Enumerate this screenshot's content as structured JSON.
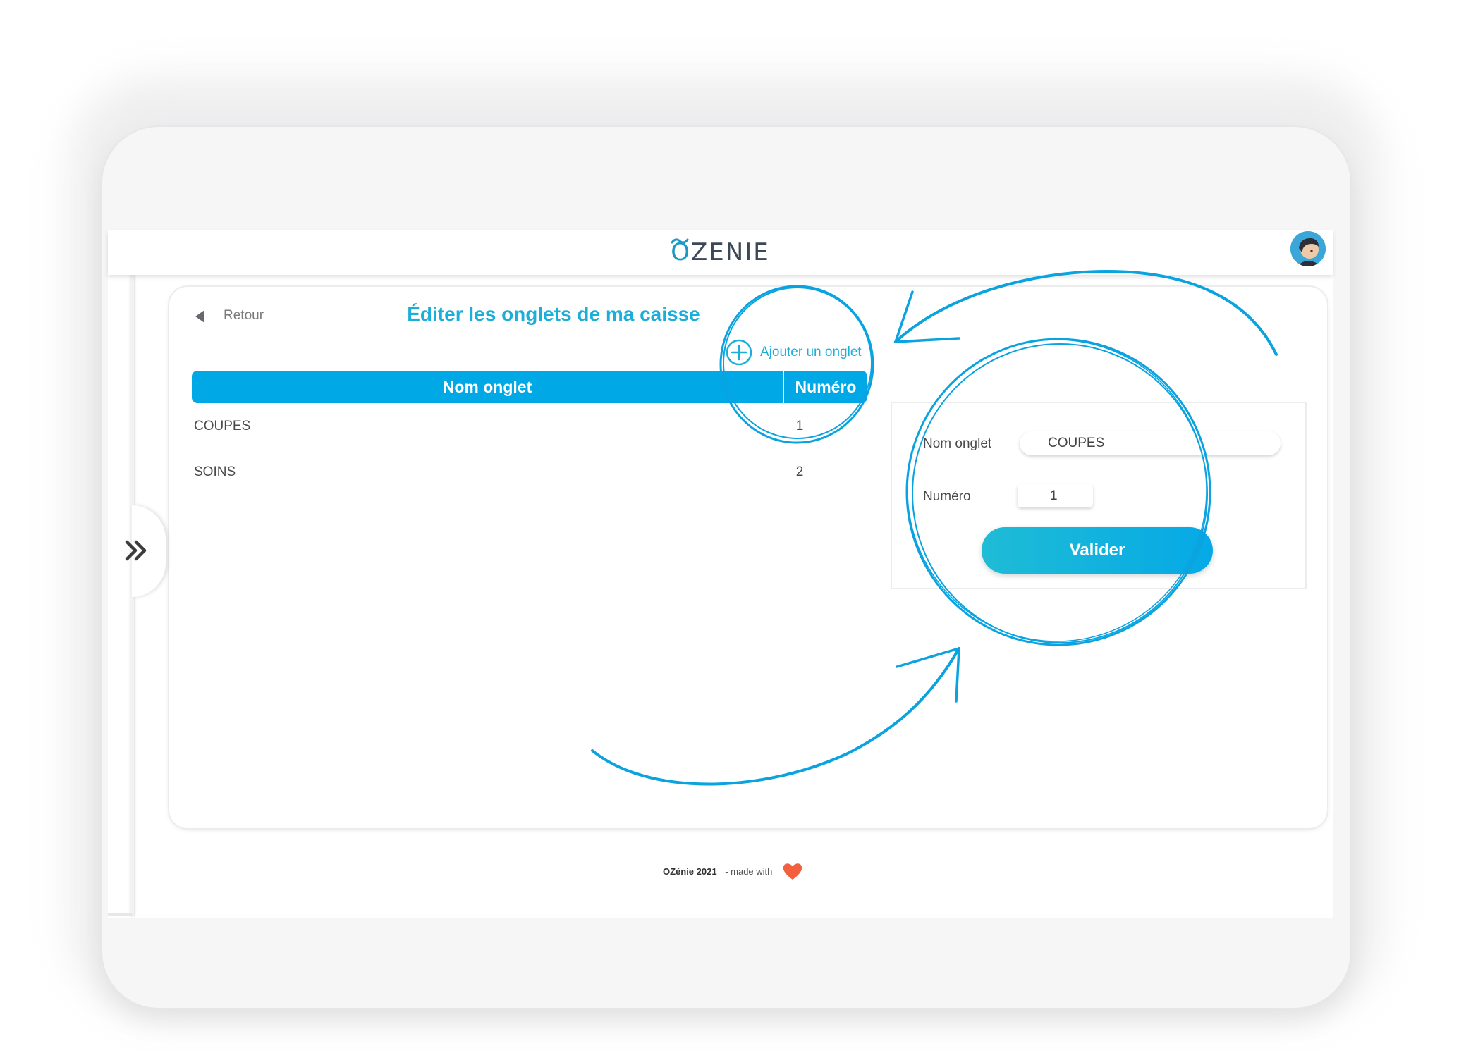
{
  "header": {
    "logo_text": "ZENIE",
    "logo_first_letter": "O"
  },
  "page": {
    "back_label": "Retour",
    "title": "Éditer les onglets de ma caisse",
    "add_tab_label": "Ajouter un onglet"
  },
  "table": {
    "columns": [
      "Nom onglet",
      "Numéro"
    ],
    "rows": [
      {
        "name": "COUPES",
        "number": "1"
      },
      {
        "name": "SOINS",
        "number": "2"
      }
    ]
  },
  "form": {
    "name_label": "Nom onglet",
    "name_value": "COUPES",
    "number_label": "Numéro",
    "number_value": "1",
    "submit_label": "Valider"
  },
  "footer": {
    "brand": "OZénie 2021",
    "made_with": "- made with"
  },
  "colors": {
    "accent": "#00a8e6",
    "title": "#1aaed8",
    "heart": "#f2603e"
  }
}
